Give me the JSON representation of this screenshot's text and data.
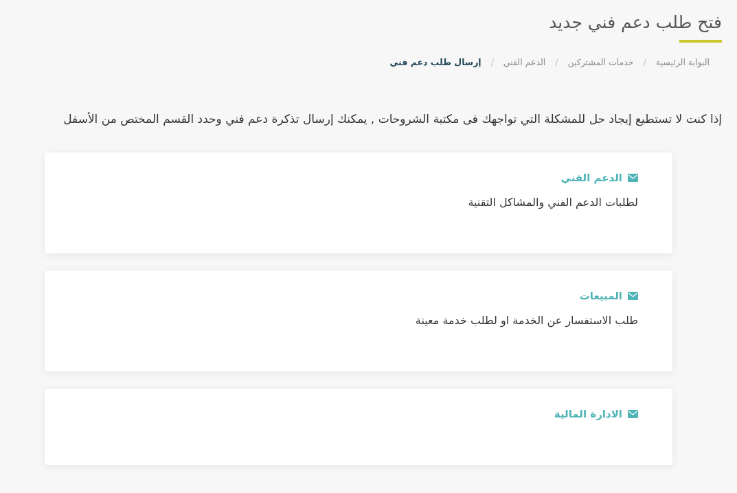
{
  "page_title": "فتح طلب دعم فني جديد",
  "breadcrumb": [
    {
      "kind": "link",
      "label": "البوابة الرئيسية"
    },
    {
      "kind": "separator",
      "label": "/"
    },
    {
      "kind": "link",
      "label": "خدمات المشتركين"
    },
    {
      "kind": "separator",
      "label": "/"
    },
    {
      "kind": "link",
      "label": "الدعم الفني"
    },
    {
      "kind": "separator",
      "label": "/"
    },
    {
      "kind": "current",
      "label": "إرسال طلب دعم فني"
    }
  ],
  "intro": "إذا كنت لا تستطيع إيجاد حل للمشكلة التي تواجهك فى مكتبة الشروحات , يمكنك إرسال تذكرة دعم فني وحدد القسم المختص من الأسفل",
  "departments": [
    {
      "title": "الدعم الفني",
      "description": "لطلبات الدعم الفني والمشاكل التقنية"
    },
    {
      "title": "المبيعات",
      "description": "طلب الاستفسار عن الخدمة او لطلب خدمة معينة"
    },
    {
      "title": "الادارة المالية"
    }
  ]
}
